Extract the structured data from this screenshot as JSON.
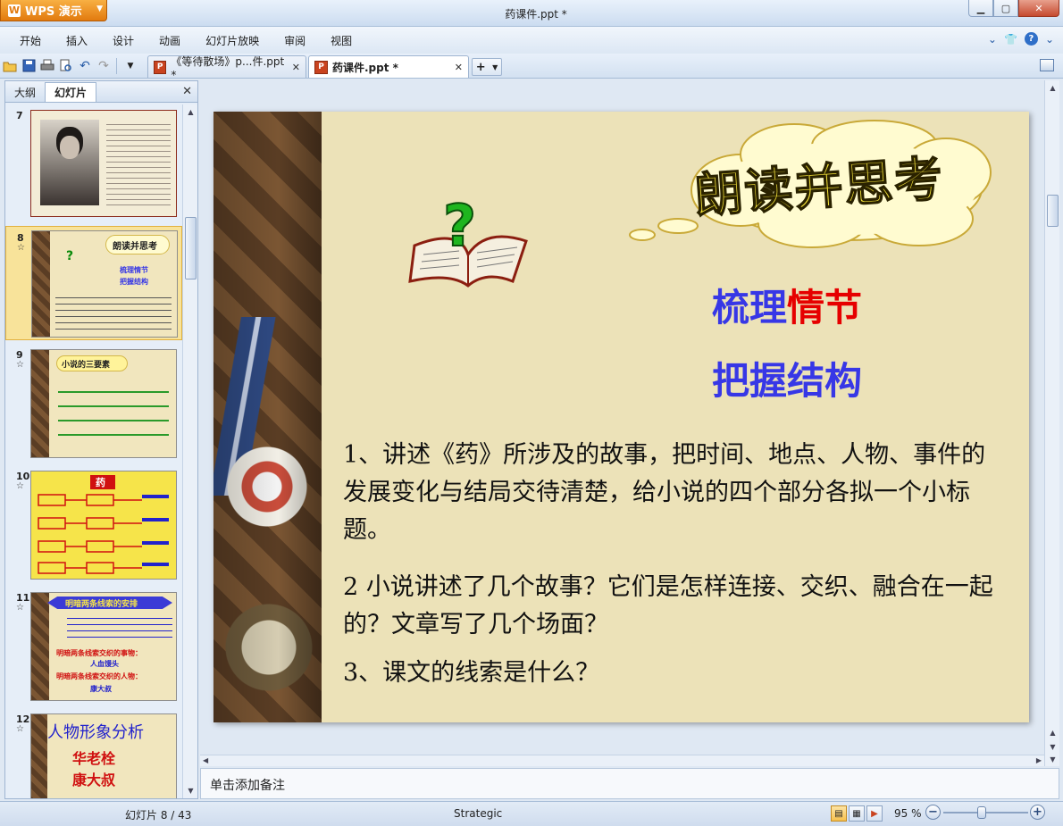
{
  "app": {
    "logo_label": "WPS 演示",
    "window_title": "药课件.ppt *"
  },
  "menu": [
    "开始",
    "插入",
    "设计",
    "动画",
    "幻灯片放映",
    "审阅",
    "视图"
  ],
  "tabs": [
    {
      "label": "《等待散场》p...件.ppt *",
      "active": false
    },
    {
      "label": "药课件.ppt *",
      "active": true
    }
  ],
  "left_pane": {
    "tabs": [
      "大纲",
      "幻灯片"
    ],
    "active_tab": "幻灯片",
    "thumbnails": [
      {
        "num": "7",
        "star": "",
        "text": ""
      },
      {
        "num": "8",
        "star": "☆",
        "selected": true,
        "title": "朗读并思考",
        "line1": "梳理情节",
        "line2": "把握结构"
      },
      {
        "num": "9",
        "star": "☆",
        "title": "小说的三要素"
      },
      {
        "num": "10",
        "star": "☆",
        "title": "药"
      },
      {
        "num": "11",
        "star": "☆",
        "title": "明暗两条线索的安排",
        "line1": "明暗两条线索交织的事物：",
        "line2": "人血馒头",
        "line3": "明暗两条线索交织的人物：",
        "line4": "康大叔"
      },
      {
        "num": "12",
        "star": "☆",
        "title": "人物形象分析",
        "line1": "华老栓",
        "line2": "康大叔"
      }
    ]
  },
  "slide": {
    "cloud_title": "朗读并思考",
    "heading1_a": "梳理",
    "heading1_b": "情节",
    "heading2": "把握结构",
    "q1": "1、讲述《药》所涉及的故事，把时间、地点、人物、事件的发展变化与结局交待清楚，给小说的四个部分各拟一个小标题。",
    "q2": "2 小说讲述了几个故事？它们是怎样连接、交织、融合在一起的？文章写了几个场面？",
    "q3": "3、课文的线索是什么？"
  },
  "notes_placeholder": "单击添加备注",
  "status": {
    "slide_indicator": "幻灯片 8 / 43",
    "theme": "Strategic",
    "zoom": "95 %"
  },
  "colors": {
    "heading_blue": "#3737e6",
    "heading_red": "#e60000",
    "cloud_text": "#f5e33a",
    "selected_thumb": "#f8e39a"
  }
}
